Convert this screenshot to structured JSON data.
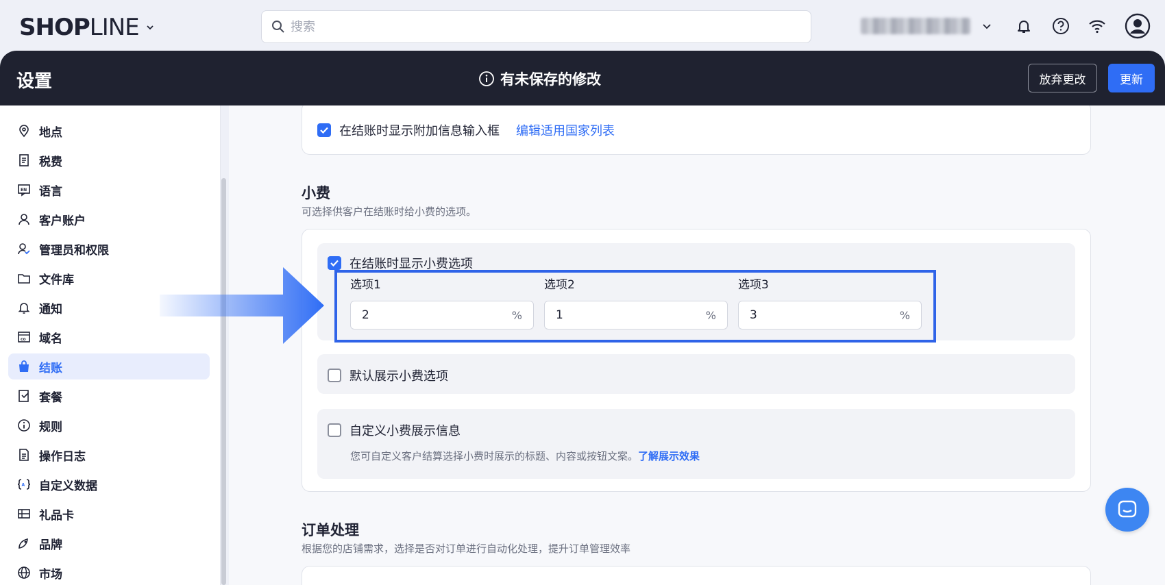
{
  "topbar": {
    "logo_bold": "SHOP",
    "logo_thin": "LINE",
    "search_placeholder": "搜索"
  },
  "header": {
    "title": "设置",
    "notice": "有未保存的修改",
    "discard_label": "放弃更改",
    "update_label": "更新"
  },
  "sidebar": {
    "items": [
      {
        "label": "地点",
        "icon": "location-pin-icon"
      },
      {
        "label": "税费",
        "icon": "tax-icon"
      },
      {
        "label": "语言",
        "icon": "language-icon"
      },
      {
        "label": "客户账户",
        "icon": "user-icon"
      },
      {
        "label": "管理员和权限",
        "icon": "admin-icon"
      },
      {
        "label": "文件库",
        "icon": "folder-icon"
      },
      {
        "label": "通知",
        "icon": "bell-icon"
      },
      {
        "label": "域名",
        "icon": "domain-icon"
      },
      {
        "label": "结账",
        "icon": "bag-icon",
        "active": true
      },
      {
        "label": "套餐",
        "icon": "plan-icon"
      },
      {
        "label": "规则",
        "icon": "info-icon"
      },
      {
        "label": "操作日志",
        "icon": "log-icon"
      },
      {
        "label": "自定义数据",
        "icon": "custom-data-icon"
      },
      {
        "label": "礼品卡",
        "icon": "gift-card-icon"
      },
      {
        "label": "品牌",
        "icon": "brand-icon"
      },
      {
        "label": "市场",
        "icon": "globe-icon"
      }
    ]
  },
  "main": {
    "extra_info": {
      "checkbox_label": "在结账时显示附加信息输入框",
      "link": "编辑适用国家列表"
    },
    "tips": {
      "title": "小费",
      "desc": "可选择供客户在结账时给小费的选项。",
      "show_label": "在结账时显示小费选项",
      "options": [
        {
          "label": "选项1",
          "value": "2",
          "unit": "%"
        },
        {
          "label": "选项2",
          "value": "1",
          "unit": "%"
        },
        {
          "label": "选项3",
          "value": "3",
          "unit": "%"
        }
      ],
      "default_label": "默认展示小费选项",
      "custom_label": "自定义小费展示信息",
      "custom_desc": "您可自定义客户结算选择小费时展示的标题、内容或按钮文案。",
      "custom_link": "了解展示效果"
    },
    "orders": {
      "title": "订单处理",
      "desc": "根据您的店铺需求，选择是否对订单进行自动化处理，提升订单管理效率"
    }
  },
  "colors": {
    "accent": "#2f6df5",
    "header_bg": "#1f2230",
    "highlight": "#2f63e8"
  }
}
